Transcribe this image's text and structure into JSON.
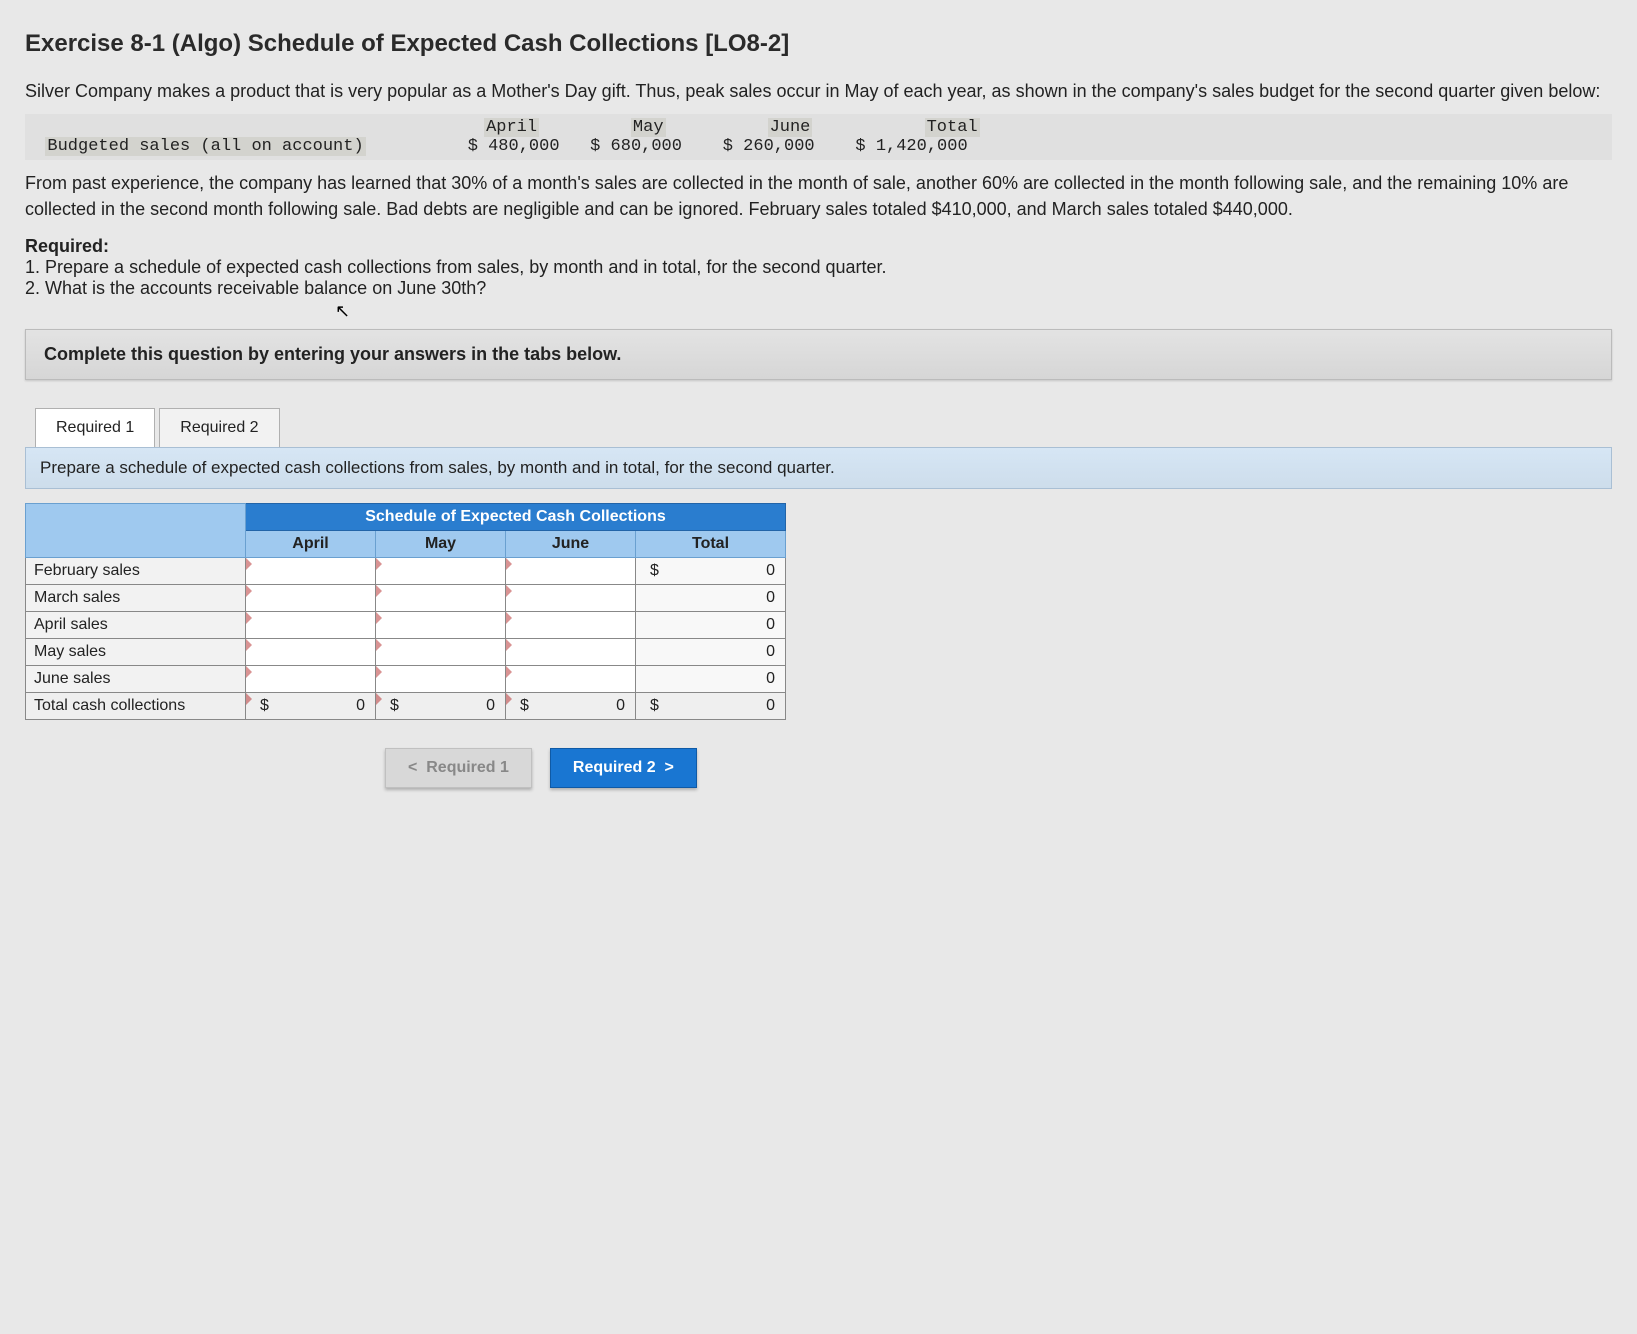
{
  "title": "Exercise 8-1 (Algo) Schedule of Expected Cash Collections [LO8-2]",
  "intro": "Silver Company makes a product that is very popular as a Mother's Day gift. Thus, peak sales occur in May of each year, as shown in the company's sales budget for the second quarter given below:",
  "budget_table": {
    "label": "Budgeted sales (all on account)",
    "cols": [
      "April",
      "May",
      "June",
      "Total"
    ],
    "values": [
      "$ 480,000",
      "$ 680,000",
      "$ 260,000",
      "$ 1,420,000"
    ]
  },
  "para2": "From past experience, the company has learned that 30% of a month's sales are collected in the month of sale, another 60% are collected in the month following sale, and the remaining 10% are collected in the second month following sale. Bad debts are negligible and can be ignored. February sales totaled $410,000, and March sales totaled $440,000.",
  "required_head": "Required:",
  "required_items": [
    "1. Prepare a schedule of expected cash collections from sales, by month and in total, for the second quarter.",
    "2. What is the accounts receivable balance on June 30th?"
  ],
  "instruction": "Complete this question by entering your answers in the tabs below.",
  "tabs": {
    "t1": "Required 1",
    "t2": "Required 2"
  },
  "tab_desc": "Prepare a schedule of expected cash collections from sales, by month and in total, for the second quarter.",
  "schedule": {
    "title": "Schedule of Expected Cash Collections",
    "cols": [
      "April",
      "May",
      "June",
      "Total"
    ],
    "rows": [
      "February sales",
      "March sales",
      "April sales",
      "May sales",
      "June sales"
    ],
    "total_row_label": "Total cash collections",
    "row_totals": {
      "currency": "$",
      "values": [
        "0",
        "0",
        "0",
        "0",
        "0"
      ]
    },
    "col_totals": {
      "april": {
        "currency": "$",
        "value": "0"
      },
      "may": {
        "currency": "$",
        "value": "0"
      },
      "june": {
        "currency": "$",
        "value": "0"
      },
      "total": {
        "currency": "$",
        "value": "0"
      }
    }
  },
  "nav": {
    "prev": "Required 1",
    "next": "Required 2"
  }
}
